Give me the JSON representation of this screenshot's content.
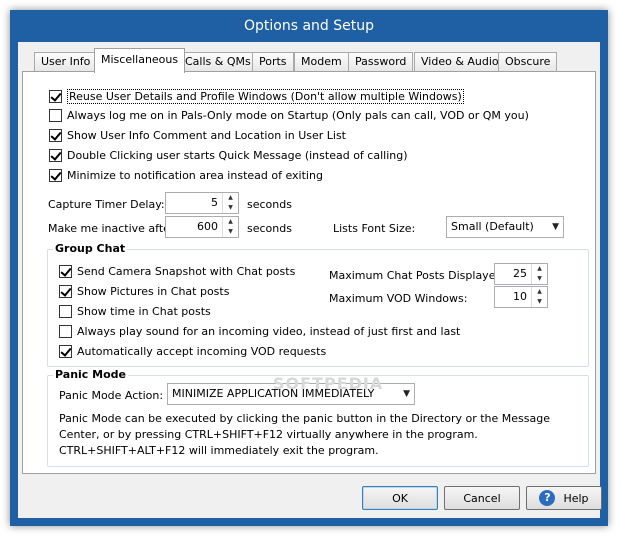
{
  "window": {
    "title": "Options and Setup"
  },
  "tabs": [
    {
      "label": "User Info",
      "active": false
    },
    {
      "label": "Miscellaneous",
      "active": true
    },
    {
      "label": "Calls & QMs",
      "active": false
    },
    {
      "label": "Ports",
      "active": false
    },
    {
      "label": "Modem",
      "active": false
    },
    {
      "label": "Password",
      "active": false
    },
    {
      "label": "Video & Audio",
      "active": false
    },
    {
      "label": "Obscure",
      "active": false
    }
  ],
  "general_options": [
    {
      "label": "Reuse User Details and Profile Windows (Don't allow multiple Windows)",
      "checked": true
    },
    {
      "label": "Always log me on in Pals-Only mode on Startup (Only pals can call, VOD or QM you)",
      "checked": false
    },
    {
      "label": "Show User Info Comment and Location in User List",
      "checked": true
    },
    {
      "label": "Double Clicking user starts Quick Message (instead of calling)",
      "checked": true
    },
    {
      "label": "Minimize to notification area instead of exiting",
      "checked": true
    }
  ],
  "capture_timer": {
    "label": "Capture Timer Delay:",
    "value": "5",
    "unit": "seconds"
  },
  "inactive": {
    "label": "Make me inactive after",
    "value": "600",
    "unit": "seconds"
  },
  "font_size": {
    "label": "Lists Font Size:",
    "value": "Small (Default)"
  },
  "group_chat": {
    "title": "Group Chat",
    "options": [
      {
        "label": "Send Camera Snapshot with Chat posts",
        "checked": true
      },
      {
        "label": "Show Pictures in Chat posts",
        "checked": true
      },
      {
        "label": "Show time in Chat posts",
        "checked": false
      },
      {
        "label": "Always play sound for an incoming video, instead of just first and last",
        "checked": false
      },
      {
        "label": "Automatically accept incoming VOD requests",
        "checked": true
      }
    ],
    "max_posts": {
      "label": "Maximum Chat Posts Displayed:",
      "value": "25"
    },
    "max_vod": {
      "label": "Maximum VOD Windows:",
      "value": "10"
    }
  },
  "panic_mode": {
    "title": "Panic Mode",
    "action_label": "Panic Mode Action:",
    "action_value": "MINIMIZE APPLICATION IMMEDIATELY",
    "description": "Panic Mode can be executed by clicking the panic button in the Directory or the Message Center, or by pressing CTRL+SHIFT+F12 virtually anywhere in the program. CTRL+SHIFT+ALT+F12 will immediately exit the program."
  },
  "watermark": "SOFTPEDIA",
  "buttons": {
    "ok": "OK",
    "cancel": "Cancel",
    "help": "Help"
  },
  "icons": {
    "help": "help-icon",
    "spin_up": "spin-up-icon",
    "spin_down": "spin-down-icon",
    "dropdown": "chevron-down-icon"
  }
}
